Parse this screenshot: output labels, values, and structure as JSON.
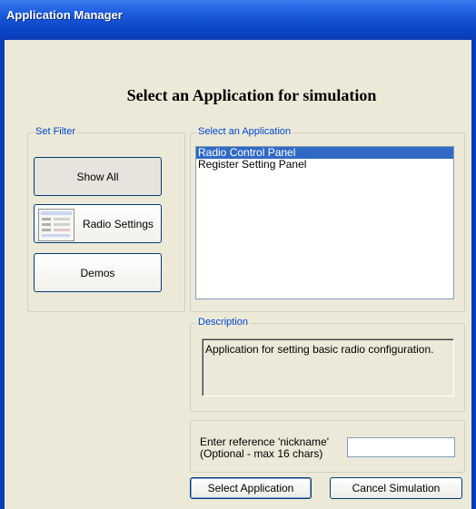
{
  "window": {
    "title": "Application Manager"
  },
  "heading": "Select an Application for simulation",
  "filter": {
    "legend": "Set Filter",
    "buttons": [
      {
        "label": "Show All"
      },
      {
        "label": "Radio Settings"
      },
      {
        "label": "Demos"
      }
    ]
  },
  "applications": {
    "legend": "Select an Application",
    "items": [
      {
        "label": "Radio Control Panel",
        "selected": true
      },
      {
        "label": "Register Setting Panel",
        "selected": false
      }
    ]
  },
  "description": {
    "legend": "Description",
    "text": "Application for setting basic radio configuration."
  },
  "nickname": {
    "label_line1": "Enter reference 'nickname'",
    "label_line2": "(Optional - max 16 chars)",
    "value": "",
    "placeholder": ""
  },
  "actions": {
    "select_label": "Select Application",
    "cancel_label": "Cancel Simulation"
  },
  "colors": {
    "title_bar": "#0a3cb5",
    "selection": "#316ac5",
    "legend_text": "#0046d5",
    "window_bg": "#ece9d8"
  }
}
